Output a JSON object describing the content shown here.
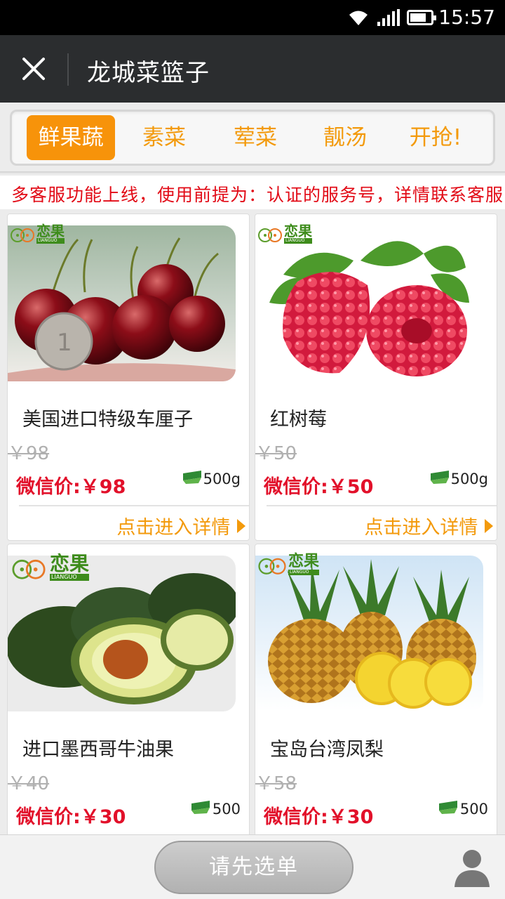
{
  "status": {
    "time": "15:57",
    "battery_level": 0.8
  },
  "nav": {
    "title": "龙城菜篮子"
  },
  "tabs": [
    {
      "label": "鲜果蔬",
      "active": true
    },
    {
      "label": "素菜",
      "active": false
    },
    {
      "label": "荤菜",
      "active": false
    },
    {
      "label": "靓汤",
      "active": false
    },
    {
      "label": "开抢!",
      "active": false
    }
  ],
  "notice": "多客服功能上线，使用前提为：认证的服务号，详情联系客服",
  "brand": {
    "cn": "恋果",
    "en": "LIANGUO"
  },
  "products": [
    {
      "name": "美国进口特级车厘子",
      "orig_price": "￥98",
      "wx_price": "微信价:￥98",
      "weight": "500g",
      "detail": "点击进入详情",
      "image": "cherries"
    },
    {
      "name": "红树莓",
      "orig_price": "￥50",
      "wx_price": "微信价:￥50",
      "weight": "500g",
      "detail": "点击进入详情",
      "image": "raspberries"
    },
    {
      "name": "进口墨西哥牛油果",
      "orig_price": "￥40",
      "wx_price": "微信价:￥30",
      "weight": "500",
      "detail": "",
      "image": "avocados"
    },
    {
      "name": "宝岛台湾凤梨",
      "orig_price": "￥58",
      "wx_price": "微信价:￥30",
      "weight": "500",
      "detail": "",
      "image": "pineapples"
    }
  ],
  "bottom": {
    "order_button": "请先选单"
  },
  "colors": {
    "accent": "#f7930a",
    "price_red": "#e2102a",
    "nav_bg": "#2b2d2f"
  },
  "icons": [
    "wifi-icon",
    "signal-icon",
    "battery-icon",
    "close-icon",
    "weight-scale-icon",
    "chevron-right-icon",
    "user-icon"
  ]
}
